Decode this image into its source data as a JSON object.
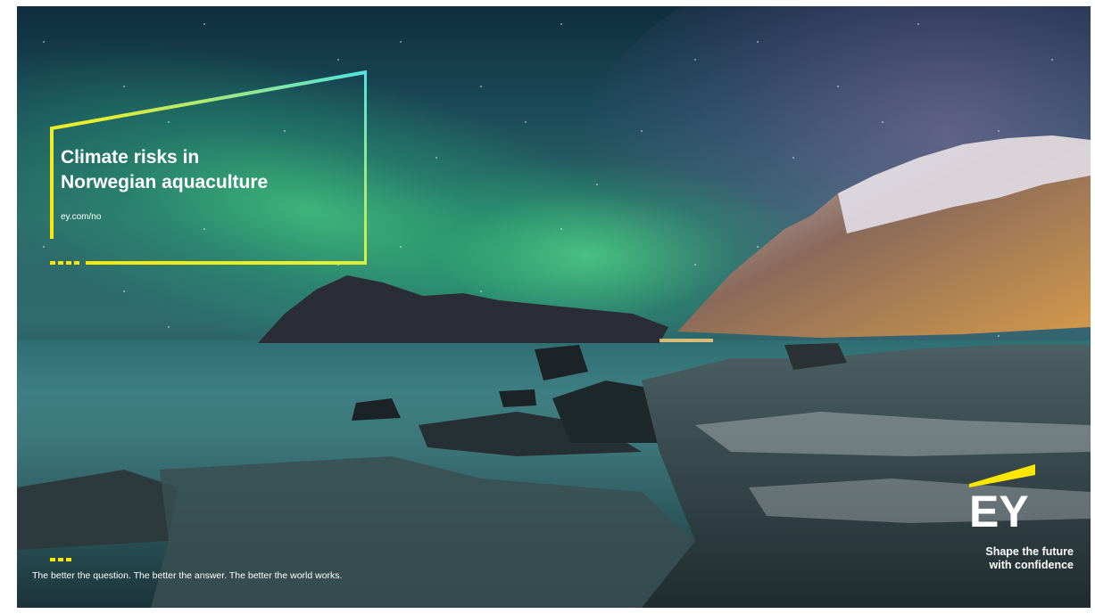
{
  "headline": {
    "line1": "Climate risks in",
    "line2": "Norwegian aquaculture"
  },
  "url": "ey.com/no",
  "tagline": "The better the question. The better the answer. The better the world works.",
  "brand": {
    "logo_text": "EY",
    "slogan_line1": "Shape the future",
    "slogan_line2": "with confidence"
  },
  "colors": {
    "brand_yellow": "#FFE600",
    "frame_gradient_end": "#4FE3E0"
  }
}
